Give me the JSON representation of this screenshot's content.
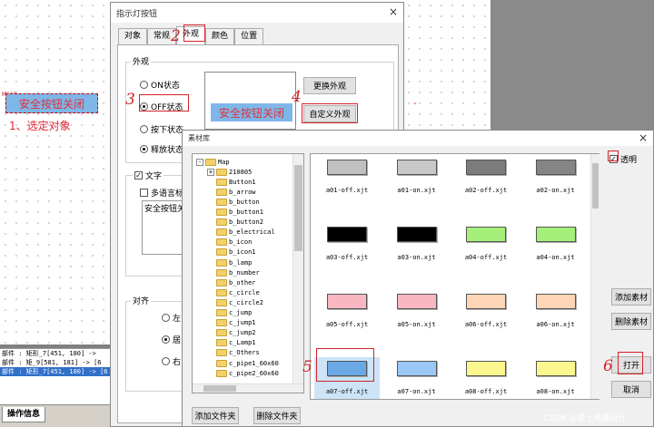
{
  "workspace": {
    "object_small_label": "M110",
    "object_button_text": "安全按钮关闭",
    "step1_text": "1、选定对象",
    "stray_mark": "-"
  },
  "log": {
    "rows": [
      "部件 : 矩形_7[451, 180] ->",
      "部件 : 矩_9[581, 181] -> [6",
      "部件 : 矩形_7[451, 180] -> [6"
    ],
    "tab_label": "操作信息"
  },
  "props_dialog": {
    "title": "指示灯按钮",
    "close_icon": "×",
    "tabs": [
      "对象",
      "常规",
      "外观",
      "颜色",
      "位置"
    ],
    "appearance_group_label": "外观",
    "radios": [
      {
        "label": "ON状态",
        "checked": false
      },
      {
        "label": "OFF状态",
        "checked": true
      },
      {
        "label": "按下状态",
        "checked": false
      },
      {
        "label": "释放状态",
        "checked": true
      }
    ],
    "preview_text": "安全按钮关闭",
    "change_appearance_label": "更换外观",
    "custom_appearance_label": "自定义外观",
    "text_checkbox_label": "文字",
    "multilang_label": "多语言标",
    "text_value": "安全按钮关",
    "align_group_label": "对齐",
    "align_options": [
      "左",
      "居",
      "右"
    ]
  },
  "annotations": [
    "2",
    "3",
    "4",
    "5",
    "6"
  ],
  "library_dialog": {
    "title": "素材库",
    "close_icon": "×",
    "tree": [
      {
        "label": "Map",
        "expander": "-",
        "level": 0
      },
      {
        "label": "210805",
        "expander": "+",
        "level": 1
      },
      {
        "label": "Button1",
        "expander": "",
        "level": 1
      },
      {
        "label": "b_arrow",
        "expander": "",
        "level": 1
      },
      {
        "label": "b_button",
        "expander": "",
        "level": 1
      },
      {
        "label": "b_button1",
        "expander": "",
        "level": 1
      },
      {
        "label": "b_button2",
        "expander": "",
        "level": 1
      },
      {
        "label": "b_electrical",
        "expander": "",
        "level": 1
      },
      {
        "label": "b_icon",
        "expander": "",
        "level": 1
      },
      {
        "label": "b_icon1",
        "expander": "",
        "level": 1
      },
      {
        "label": "b_lamp",
        "expander": "",
        "level": 1
      },
      {
        "label": "b_number",
        "expander": "",
        "level": 1
      },
      {
        "label": "b_other",
        "expander": "",
        "level": 1
      },
      {
        "label": "c_circle",
        "expander": "",
        "level": 1
      },
      {
        "label": "c_circle2",
        "expander": "",
        "level": 1
      },
      {
        "label": "c_jump",
        "expander": "",
        "level": 1
      },
      {
        "label": "c_jump1",
        "expander": "",
        "level": 1
      },
      {
        "label": "c_jump2",
        "expander": "",
        "level": 1
      },
      {
        "label": "c_Lamp1",
        "expander": "",
        "level": 1
      },
      {
        "label": "c_Others",
        "expander": "",
        "level": 1
      },
      {
        "label": "c_pipe1_60x60",
        "expander": "",
        "level": 1
      },
      {
        "label": "c_pipe2_60x60",
        "expander": "",
        "level": 1
      }
    ],
    "items": [
      {
        "name": "a01-off.xjt",
        "color": "#c0c0c0"
      },
      {
        "name": "a01-on.xjt",
        "color": "#c8c8c8"
      },
      {
        "name": "a02-off.xjt",
        "color": "#7c7c7c"
      },
      {
        "name": "a02-on.xjt",
        "color": "#858585"
      },
      {
        "name": "a03-off.xjt",
        "color": "#000000"
      },
      {
        "name": "a03-on.xjt",
        "color": "#000000"
      },
      {
        "name": "a04-off.xjt",
        "color": "#a4f07a"
      },
      {
        "name": "a04-on.xjt",
        "color": "#a4f07a"
      },
      {
        "name": "a05-off.xjt",
        "color": "#f9b7c2"
      },
      {
        "name": "a05-on.xjt",
        "color": "#f9b7c2"
      },
      {
        "name": "a06-off.xjt",
        "color": "#fcd6b6"
      },
      {
        "name": "a06-on.xjt",
        "color": "#fcd6b6"
      },
      {
        "name": "a07-off.xjt",
        "color": "#6aa9e6"
      },
      {
        "name": "a07-on.xjt",
        "color": "#9ac9f6"
      },
      {
        "name": "a08-off.xjt",
        "color": "#fcf68e"
      },
      {
        "name": "a08-on.xjt",
        "color": "#fcf68e"
      }
    ],
    "selected_item": "a07-off.xjt",
    "transparent_label": "透明",
    "transparent_checked": true,
    "add_material_label": "添加素材",
    "delete_material_label": "删除素材",
    "open_label": "打开",
    "cancel_label": "取消",
    "add_folder_label": "添加文件夹",
    "delete_folder_label": "删除文件夹"
  },
  "watermark": "CSDN @爱上电路设计"
}
